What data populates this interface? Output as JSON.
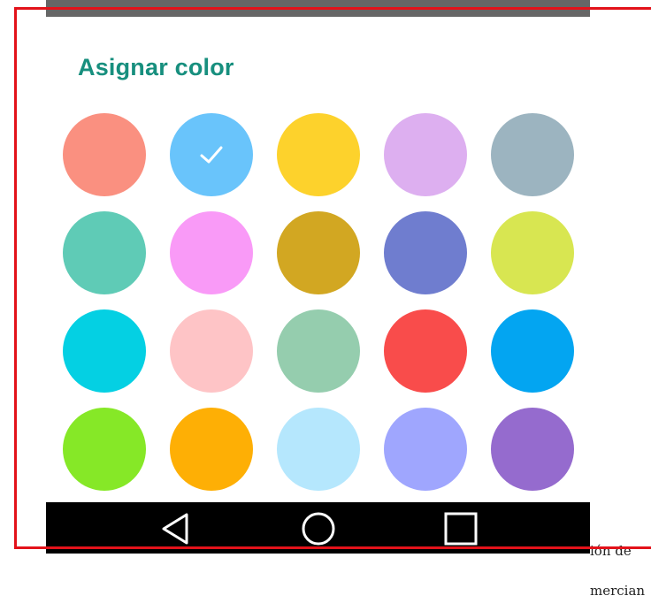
{
  "dialog": {
    "title": "Asignar color",
    "swatches": [
      {
        "color": "#fa9080",
        "selected": false
      },
      {
        "color": "#69c4fb",
        "selected": true
      },
      {
        "color": "#fdd22c",
        "selected": false
      },
      {
        "color": "#ddaff0",
        "selected": false
      },
      {
        "color": "#9cb4c0",
        "selected": false
      },
      {
        "color": "#5fcbb6",
        "selected": false
      },
      {
        "color": "#f99af7",
        "selected": false
      },
      {
        "color": "#d2a722",
        "selected": false
      },
      {
        "color": "#6f7dcf",
        "selected": false
      },
      {
        "color": "#d8e651",
        "selected": false
      },
      {
        "color": "#04d0e3",
        "selected": false
      },
      {
        "color": "#fec4c6",
        "selected": false
      },
      {
        "color": "#95cdae",
        "selected": false
      },
      {
        "color": "#f94c4b",
        "selected": false
      },
      {
        "color": "#03a5f1",
        "selected": false
      },
      {
        "color": "#86e827",
        "selected": false
      },
      {
        "color": "#feaf05",
        "selected": false
      },
      {
        "color": "#b5e7fd",
        "selected": false
      },
      {
        "color": "#9fa6fe",
        "selected": false
      },
      {
        "color": "#956bce",
        "selected": false
      }
    ]
  },
  "navbar": {
    "buttons": [
      {
        "name": "back-icon"
      },
      {
        "name": "home-icon"
      },
      {
        "name": "recents-icon"
      }
    ]
  },
  "overlay": {
    "lines": [
      "ión de",
      "mercian"
    ]
  },
  "colors": {
    "title": "#178f7e",
    "frame": "#e3121a",
    "statusbar": "#666666",
    "navbar": "#000000",
    "check": "#ffffff"
  }
}
